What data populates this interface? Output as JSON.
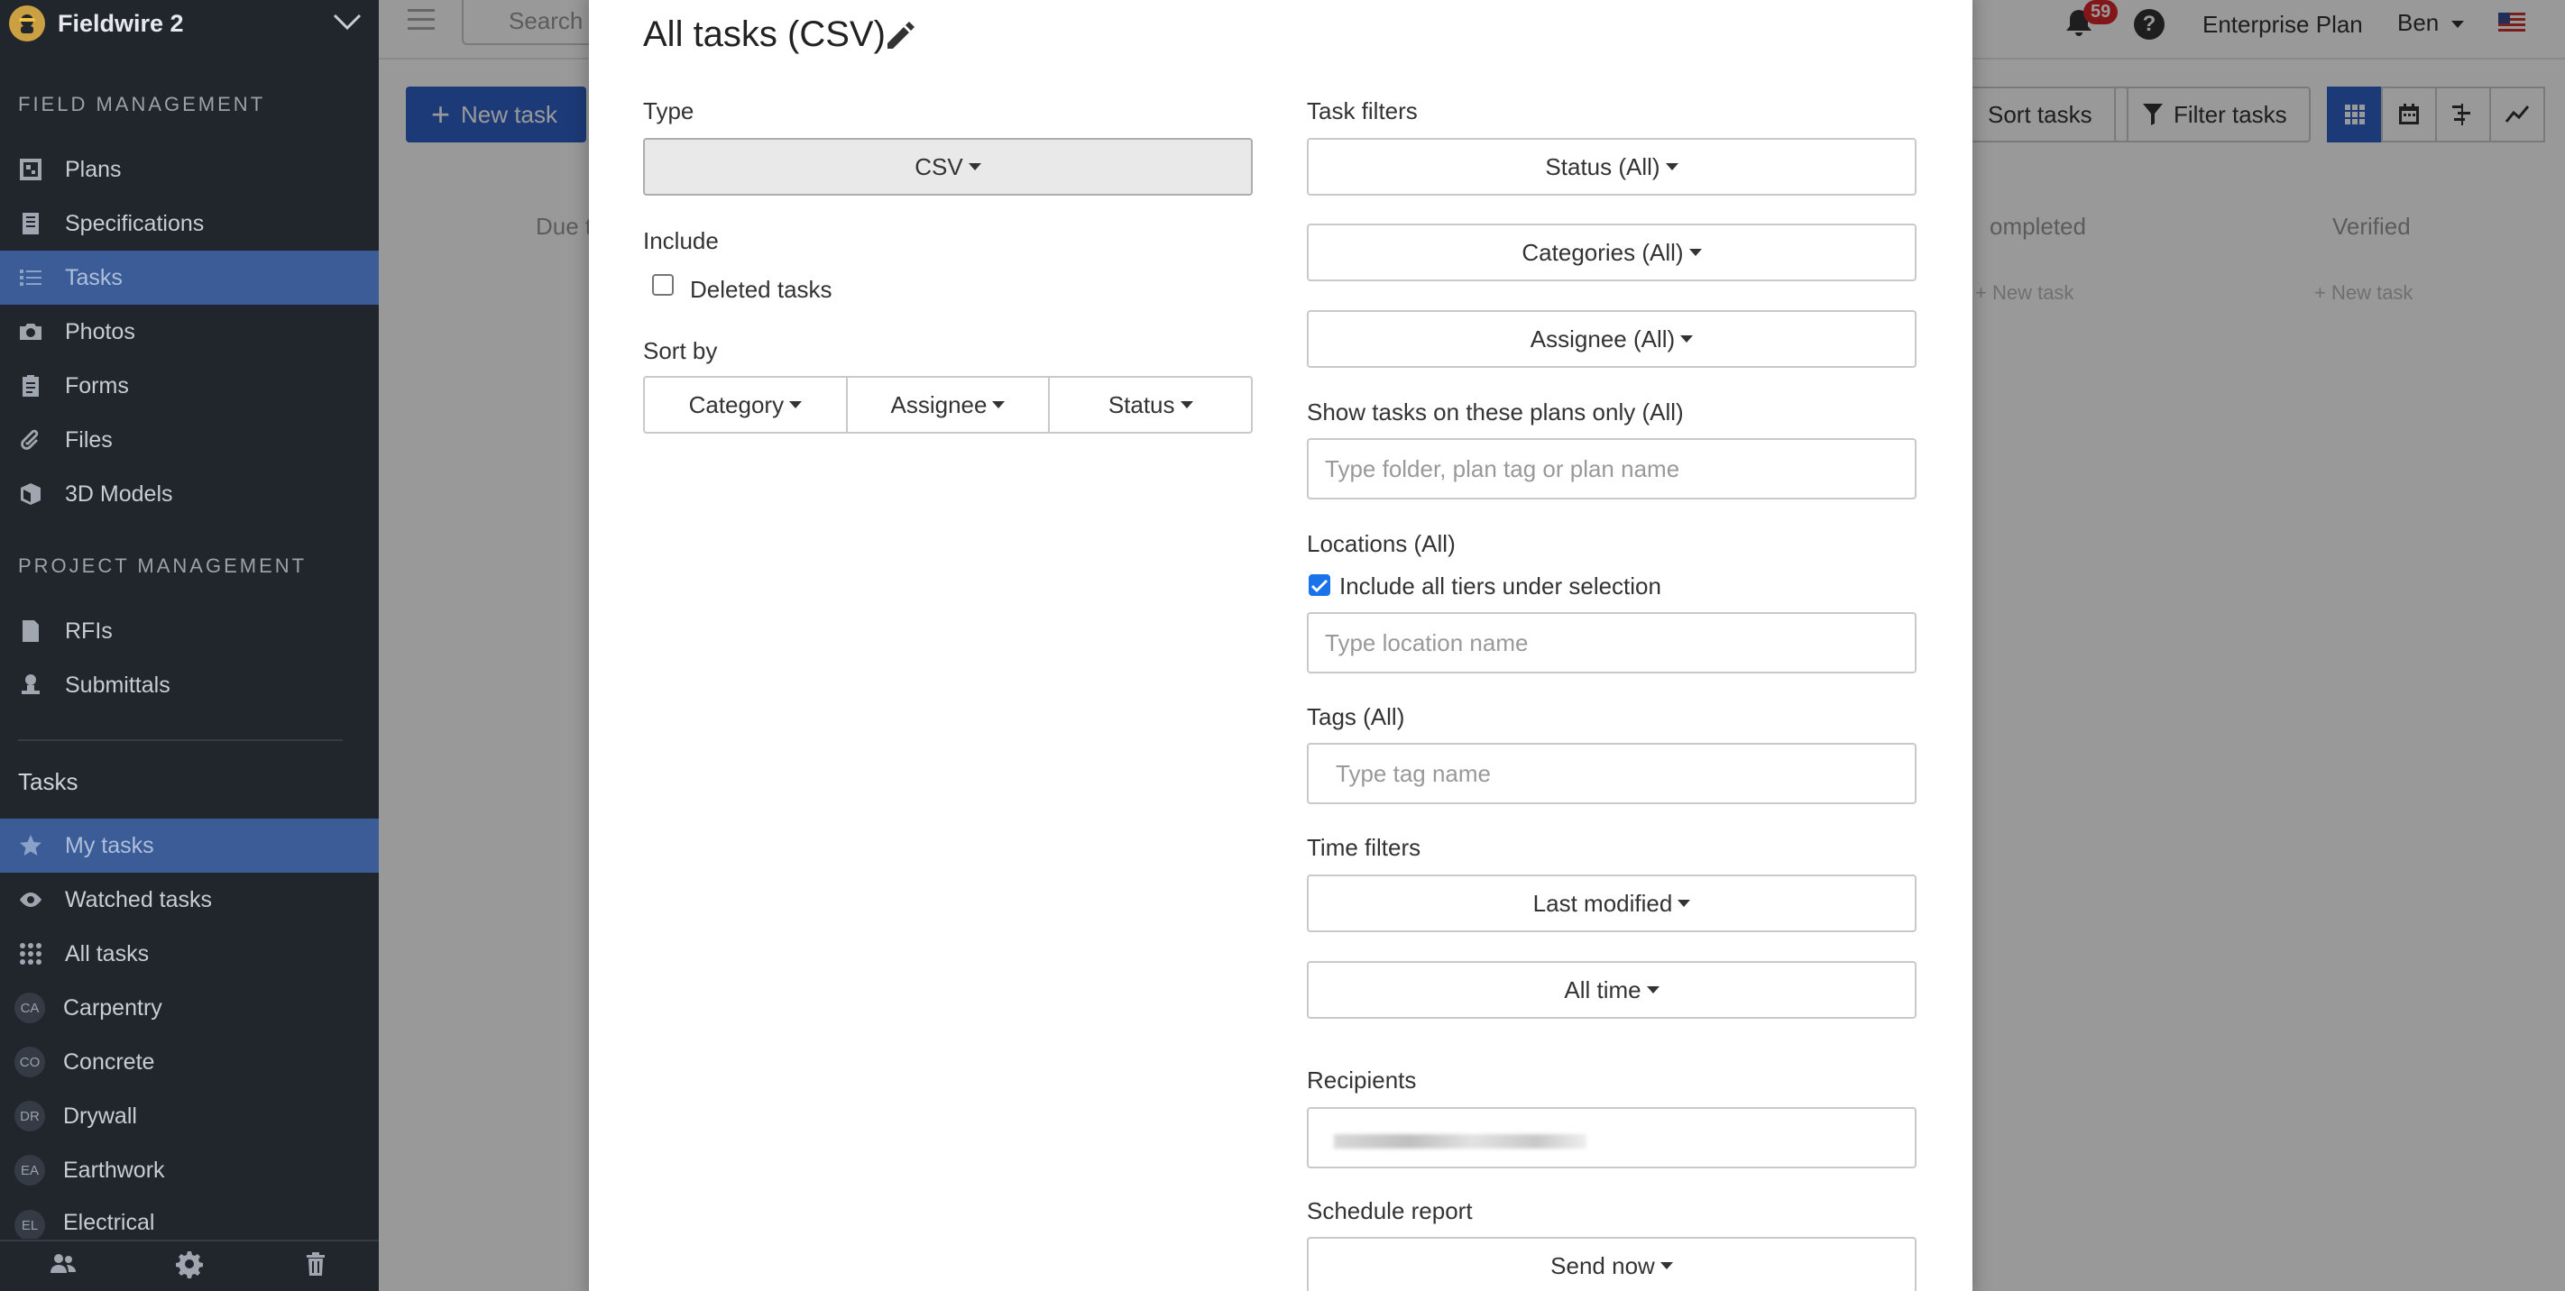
{
  "sidebar": {
    "project_name": "Fieldwire 2",
    "field_management_title": "FIELD MANAGEMENT",
    "field_items": [
      {
        "label": "Plans",
        "icon": "plans-icon"
      },
      {
        "label": "Specifications",
        "icon": "specifications-icon"
      },
      {
        "label": "Tasks",
        "icon": "tasks-list-icon",
        "active": true
      },
      {
        "label": "Photos",
        "icon": "camera-icon"
      },
      {
        "label": "Forms",
        "icon": "clipboard-icon"
      },
      {
        "label": "Files",
        "icon": "paperclip-icon"
      },
      {
        "label": "3D Models",
        "icon": "cube-icon"
      }
    ],
    "project_management_title": "PROJECT MANAGEMENT",
    "project_items": [
      {
        "label": "RFIs",
        "icon": "rfi-icon"
      },
      {
        "label": "Submittals",
        "icon": "submittals-icon"
      }
    ],
    "tasks_title": "Tasks",
    "task_items": [
      {
        "label": "My tasks",
        "icon": "star-icon",
        "active": true
      },
      {
        "label": "Watched tasks",
        "icon": "eye-icon"
      },
      {
        "label": "All tasks",
        "icon": "grid-dots-icon"
      },
      {
        "label": "Carpentry",
        "badge": "CA"
      },
      {
        "label": "Concrete",
        "badge": "CO"
      },
      {
        "label": "Drywall",
        "badge": "DR"
      },
      {
        "label": "Earthwork",
        "badge": "EA"
      },
      {
        "label": "Electrical",
        "badge": "EL"
      }
    ]
  },
  "topbar": {
    "search_label": "Search",
    "notification_count": "59",
    "help_label": "?",
    "plan_label": "Enterprise Plan",
    "user_label": "Ben"
  },
  "toolbar": {
    "new_task_label": "New task",
    "sort_label": "Sort tasks",
    "filter_label": "Filter tasks"
  },
  "columns": {
    "due_partial": "Due t",
    "completed_partial": "ompleted",
    "verified": "Verified",
    "new_task_faded": "+ New task"
  },
  "modal": {
    "title": "All tasks (CSV)",
    "type_label": "Type",
    "type_value": "CSV",
    "include_label": "Include",
    "deleted_tasks_label": "Deleted tasks",
    "deleted_tasks_checked": false,
    "sort_by_label": "Sort by",
    "sort_options": [
      "Category",
      "Assignee",
      "Status"
    ],
    "task_filters_label": "Task filters",
    "status_filter": "Status (All)",
    "categories_filter": "Categories (All)",
    "assignee_filter": "Assignee (All)",
    "plans_label": "Show tasks on these plans only (All)",
    "plans_placeholder": "Type folder, plan tag or plan name",
    "locations_label": "Locations (All)",
    "include_tiers_label": "Include all tiers under selection",
    "include_tiers_checked": true,
    "location_placeholder": "Type location name",
    "tags_label": "Tags (All)",
    "tags_placeholder": "Type tag name",
    "time_filters_label": "Time filters",
    "time_field": "Last modified",
    "time_range": "All time",
    "recipients_label": "Recipients",
    "schedule_label": "Schedule report",
    "schedule_value": "Send now"
  },
  "colors": {
    "sidebar_bg": "#21262d",
    "active_item": "#3c5c97",
    "primary_button": "#2f62c6",
    "checkbox_checked": "#1a73e8",
    "notification_badge": "#d9262a"
  }
}
